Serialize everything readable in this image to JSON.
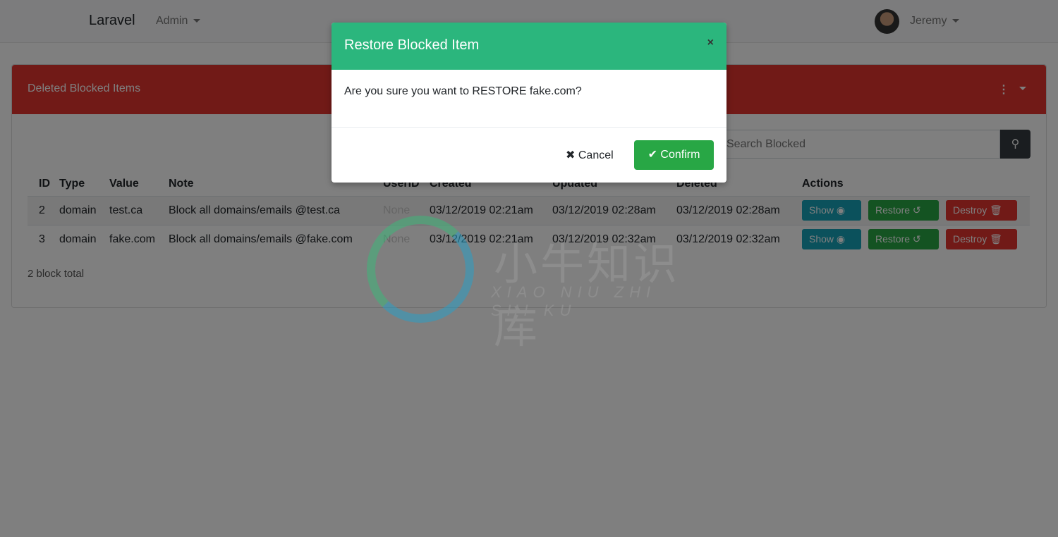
{
  "navbar": {
    "brand": "Laravel",
    "admin_menu": "Admin",
    "user_name": "Jeremy"
  },
  "card": {
    "title": "Deleted Blocked Items",
    "kebab": "⋮",
    "search_placeholder": "Search Blocked",
    "search_icon": "search-icon"
  },
  "table": {
    "headers": [
      "ID",
      "Type",
      "Value",
      "Note",
      "UserID",
      "Created",
      "Updated",
      "Deleted",
      "Actions"
    ],
    "rows": [
      {
        "id": "2",
        "type": "domain",
        "value": "test.ca",
        "note": "Block all domains/emails @test.ca",
        "userid": "None",
        "created": "03/12/2019 02:21am",
        "updated": "03/12/2019 02:28am",
        "deleted": "03/12/2019 02:28am"
      },
      {
        "id": "3",
        "type": "domain",
        "value": "fake.com",
        "note": "Block all domains/emails @fake.com",
        "userid": "None",
        "created": "03/12/2019 02:21am",
        "updated": "03/12/2019 02:32am",
        "deleted": "03/12/2019 02:32am"
      }
    ],
    "actions": {
      "show": "Show",
      "restore": "Restore",
      "destroy": "Destroy"
    }
  },
  "total": "2 block total",
  "modal": {
    "title": "Restore Blocked Item",
    "close": "×",
    "message": "Are you sure you want to RESTORE fake.com?",
    "cancel": "Cancel",
    "confirm": "Confirm"
  },
  "watermark": {
    "cn": "小牛知识库",
    "pinyin": "XIAO NIU ZHI SHI KU"
  },
  "colors": {
    "card_header": "#e3342f",
    "modal_header": "#2bb67d",
    "confirm": "#28a745",
    "show": "#17a2b8",
    "destroy": "#e3342f"
  }
}
